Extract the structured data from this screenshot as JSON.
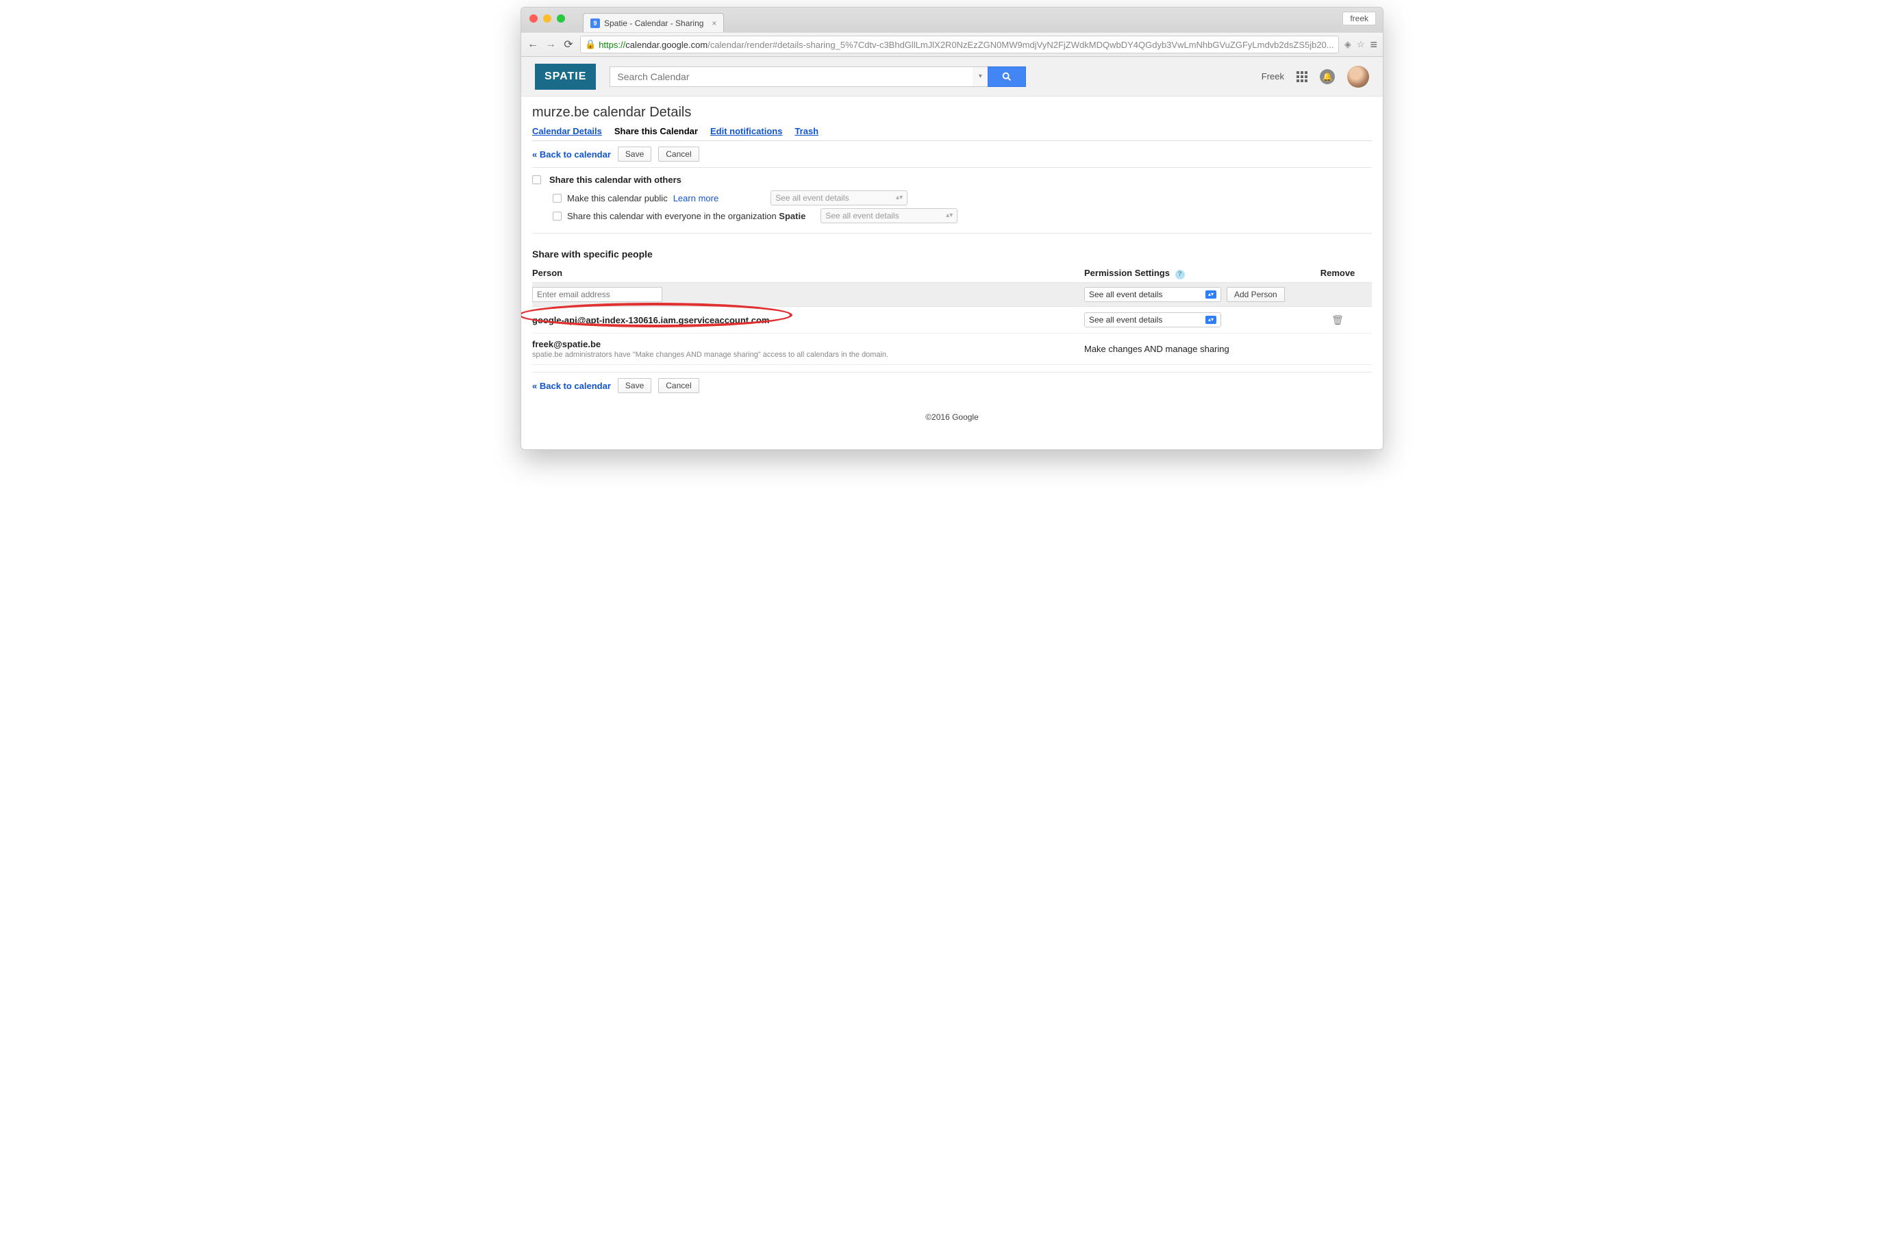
{
  "browser": {
    "profile_name": "freek",
    "tab": {
      "title": "Spatie - Calendar - Sharing",
      "badge": "9"
    },
    "url": {
      "scheme": "https",
      "host": "calendar.google.com",
      "path": "/calendar/render#details-sharing_5%7Cdtv-c3BhdGllLmJlX2R0NzEzZGN0MW9mdjVyN2FjZWdkMDQwbDY4QGdyb3VwLmNhbGVuZGFyLmdvb2dsZS5jb20..."
    }
  },
  "header": {
    "brand": "SPATIE",
    "search_placeholder": "Search Calendar",
    "user_name": "Freek"
  },
  "page": {
    "title": "murze.be calendar Details",
    "tabs": {
      "calendar_details": "Calendar Details",
      "share": "Share this Calendar",
      "edit_notifications": "Edit notifications",
      "trash": "Trash"
    },
    "back_link": "« Back to calendar",
    "save_label": "Save",
    "cancel_label": "Cancel"
  },
  "share_others": {
    "title": "Share this calendar with others",
    "make_public": "Make this calendar public",
    "learn_more": "Learn more",
    "share_org_prefix": "Share this calendar with everyone in the organization ",
    "share_org_name": "Spatie",
    "perm_option": "See all event details"
  },
  "share_people": {
    "title": "Share with specific people",
    "col_person": "Person",
    "col_permission": "Permission Settings",
    "col_remove": "Remove",
    "email_placeholder": "Enter email address",
    "add_person_label": "Add Person",
    "rows": [
      {
        "email": "google-api@apt-index-130616.iam.gserviceaccount.com",
        "permission": "See all event details",
        "removable": true
      },
      {
        "email": "freek@spatie.be",
        "permission": "Make changes AND manage sharing",
        "removable": false,
        "note": "spatie.be administrators have \"Make changes AND manage sharing\" access to all calendars in the domain."
      }
    ],
    "new_row_permission": "See all event details"
  },
  "footer": "©2016 Google"
}
